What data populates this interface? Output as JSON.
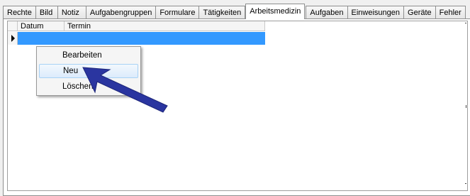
{
  "tabs": [
    {
      "label": "Rechte",
      "active": false
    },
    {
      "label": "Bild",
      "active": false
    },
    {
      "label": "Notiz",
      "active": false
    },
    {
      "label": "Aufgabengruppen",
      "active": false
    },
    {
      "label": "Formulare",
      "active": false
    },
    {
      "label": "Tätigkeiten",
      "active": false
    },
    {
      "label": "Arbeitsmedizin",
      "active": true
    },
    {
      "label": "Aufgaben",
      "active": false
    },
    {
      "label": "Einweisungen",
      "active": false
    },
    {
      "label": "Geräte",
      "active": false
    },
    {
      "label": "Fehler",
      "active": false
    }
  ],
  "grid": {
    "columns": [
      "Datum",
      "Termin"
    ],
    "rows": [
      {
        "datum": "",
        "termin": "",
        "selected": true
      }
    ]
  },
  "context_menu": {
    "items": [
      {
        "label": "Bearbeiten",
        "highlighted": false
      },
      {
        "label": "Neu",
        "highlighted": true
      },
      {
        "label": "Löschen",
        "highlighted": false
      }
    ]
  },
  "annotation": {
    "icon": "pointer-arrow-icon",
    "color": "#2a35a0"
  },
  "colors": {
    "selection": "#3399ff",
    "accent": "#2a35a0"
  }
}
